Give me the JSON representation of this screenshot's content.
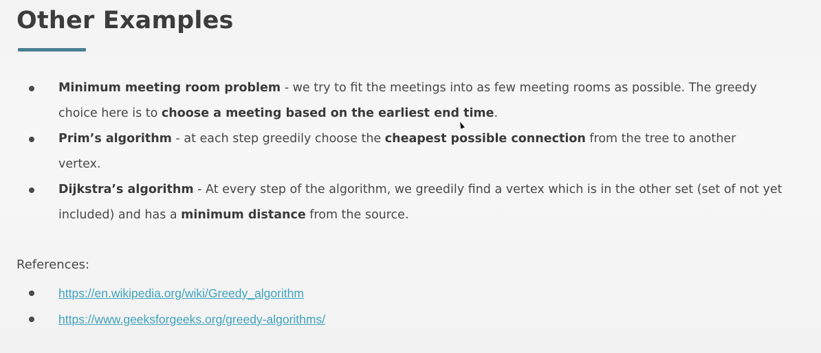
{
  "slide": {
    "title": "Other Examples",
    "accent_color": "#4a7f93",
    "link_color": "#3fa2bd"
  },
  "bullets": [
    {
      "strong": "Minimum meeting room problem",
      "text1": " - we try to fit the meetings into as few meeting rooms as possible. The greedy choice here is to ",
      "strong2": "choose a meeting based on the earliest end time",
      "text2": "."
    },
    {
      "strong": "Prim’s algorithm",
      "text1": " - at each step greedily choose the ",
      "strong2": "cheapest possible connection",
      "text2": " from the tree to another vertex."
    },
    {
      "strong": "Dijkstra’s algorithm",
      "text1": " - At every step of the algorithm, we greedily find a vertex which is in the other set (set of not yet included) and has a ",
      "strong2": "minimum distance",
      "text2": " from the source."
    }
  ],
  "references": {
    "label": "References:",
    "links": [
      "https://en.wikipedia.org/wiki/Greedy_algorithm",
      "https://www.geeksforgeeks.org/greedy-algorithms/"
    ]
  }
}
